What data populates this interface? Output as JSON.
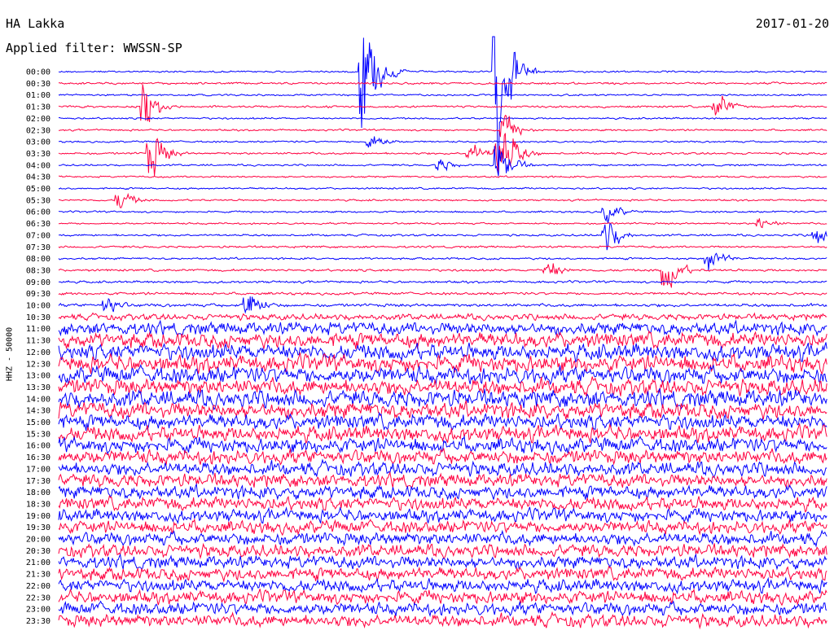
{
  "header": {
    "station": "HA Lakka",
    "date": "2017-01-20",
    "filter_label": "Applied filter: WWSSN-SP"
  },
  "chart_data": {
    "type": "line",
    "title": "HA Lakka",
    "subtitle": "Applied filter: WWSSN-SP",
    "date": "2017-01-20",
    "ylabel": "HHZ - 50000",
    "xlabel": "",
    "row_labels": [
      "00:00",
      "00:30",
      "01:00",
      "01:30",
      "02:00",
      "02:30",
      "03:00",
      "03:30",
      "04:00",
      "04:30",
      "05:00",
      "05:30",
      "06:00",
      "06:30",
      "07:00",
      "07:30",
      "08:00",
      "08:30",
      "09:00",
      "09:30",
      "10:00",
      "10:30",
      "11:00",
      "11:30",
      "12:00",
      "12:30",
      "13:00",
      "13:30",
      "14:00",
      "14:30",
      "15:00",
      "15:30",
      "16:00",
      "16:30",
      "17:00",
      "17:30",
      "18:00",
      "18:30",
      "19:00",
      "19:30",
      "20:00",
      "20:30",
      "21:00",
      "21:30",
      "22:00",
      "22:30",
      "23:00",
      "23:30"
    ],
    "row_colors": [
      "#0000ff",
      "#ff0040"
    ],
    "row_minutes": 30,
    "noise_levels": [
      0.35,
      0.4,
      0.35,
      0.4,
      0.35,
      0.35,
      0.35,
      0.4,
      0.35,
      0.35,
      0.35,
      0.35,
      0.35,
      0.35,
      0.4,
      0.4,
      0.4,
      0.45,
      0.45,
      0.5,
      0.6,
      1.2,
      2.5,
      3.0,
      3.2,
      3.3,
      3.3,
      3.2,
      3.4,
      3.2,
      3.0,
      3.0,
      2.9,
      2.8,
      2.7,
      2.6,
      2.6,
      2.6,
      2.5,
      2.5,
      2.5,
      2.5,
      2.5,
      2.5,
      2.5,
      2.5,
      2.5,
      2.5
    ],
    "events": [
      {
        "row": 0,
        "minute": 12,
        "amp": 18
      },
      {
        "row": 0,
        "minute": 17.2,
        "amp": 22
      },
      {
        "row": 3,
        "minute": 3.5,
        "amp": 6
      },
      {
        "row": 3,
        "minute": 25.8,
        "amp": 4
      },
      {
        "row": 5,
        "minute": 17.5,
        "amp": 4
      },
      {
        "row": 6,
        "minute": 12.3,
        "amp": 3
      },
      {
        "row": 7,
        "minute": 3.7,
        "amp": 7
      },
      {
        "row": 7,
        "minute": 17.4,
        "amp": 10
      },
      {
        "row": 7,
        "minute": 17.2,
        "amp": 4
      },
      {
        "row": 7,
        "minute": 16.2,
        "amp": 3
      },
      {
        "row": 8,
        "minute": 15.0,
        "amp": 2
      },
      {
        "row": 8,
        "minute": 17.3,
        "amp": 6
      },
      {
        "row": 11,
        "minute": 2.5,
        "amp": 3
      },
      {
        "row": 12,
        "minute": 21.5,
        "amp": 3
      },
      {
        "row": 13,
        "minute": 27.5,
        "amp": 2
      },
      {
        "row": 14,
        "minute": 21.5,
        "amp": 5
      },
      {
        "row": 14,
        "minute": 29.7,
        "amp": 3
      },
      {
        "row": 16,
        "minute": 25.5,
        "amp": 4
      },
      {
        "row": 17,
        "minute": 19.2,
        "amp": 3
      },
      {
        "row": 17,
        "minute": 23.8,
        "amp": 6
      },
      {
        "row": 20,
        "minute": 2.0,
        "amp": 3
      },
      {
        "row": 20,
        "minute": 7.5,
        "amp": 5
      }
    ]
  }
}
